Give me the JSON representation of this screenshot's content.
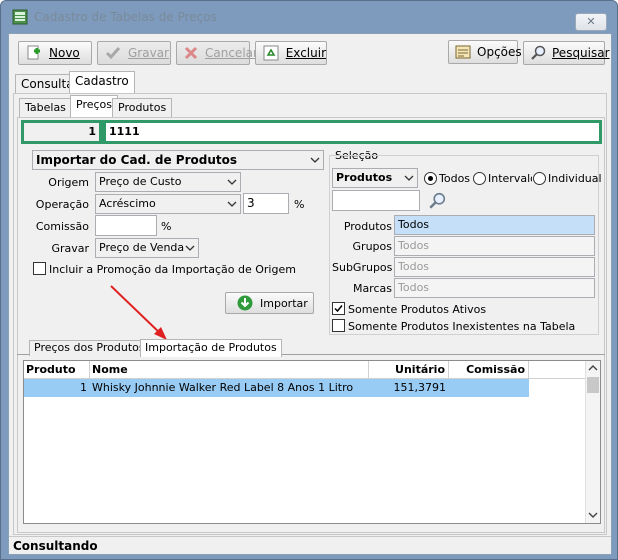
{
  "window": {
    "title": "Cadastro de Tabelas de Preços",
    "close": "✕"
  },
  "toolbar": {
    "novo": "Novo",
    "gravar": "Gravar",
    "cancelar": "Cancelar",
    "excluir": "Excluir",
    "opcoes": "Opções",
    "pesquisar": "Pesquisar"
  },
  "main_tabs": [
    "Consulta",
    "Cadastro"
  ],
  "sub_tabs": [
    "Tabelas",
    "Preços",
    "Produtos"
  ],
  "header_row": {
    "code": "1",
    "name": "1111"
  },
  "import": {
    "mode": "Importar do Cad. de Produtos",
    "origem_label": "Origem",
    "origem_value": "Preço de Custo",
    "operacao_label": "Operação",
    "operacao_value": "Acréscimo",
    "operacao_number": "3",
    "percent1": "%",
    "comissao_label": "Comissão",
    "comissao_value": "",
    "percent2": "%",
    "gravar_label": "Gravar",
    "gravar_value": "Preço de Venda",
    "incluir_label": "Incluir a Promoção da Importação de Origem",
    "incluir_checked": false,
    "importar_button": "Importar"
  },
  "selecao": {
    "title": "Seleção",
    "type_value": "Produtos",
    "radio_todos": "Todos",
    "radio_intervalo": "Intervalo",
    "radio_individual": "Individual",
    "selected_radio": "Todos",
    "search_value": "",
    "produtos_label": "Produtos",
    "produtos_value": "Todos",
    "grupos_label": "Grupos",
    "grupos_value": "Todos",
    "subgrupos_label": "SubGrupos",
    "subgrupos_value": "Todos",
    "marcas_label": "Marcas",
    "marcas_value": "Todos",
    "somente_ativos": "Somente Produtos Ativos",
    "somente_ativos_checked": true,
    "somente_inexistentes": "Somente Produtos Inexistentes na Tabela",
    "somente_inexistentes_checked": false
  },
  "bottom_tabs": [
    "Preços dos Produtos",
    "Importação de Produtos"
  ],
  "grid": {
    "headers": {
      "produto": "Produto",
      "nome": "Nome",
      "unitario": "Unitário",
      "comissao": "Comissão"
    },
    "rows": [
      {
        "produto": "1",
        "nome": "Whisky Johnnie Walker Red Label 8 Anos 1 Litro",
        "unitario": "151,3791",
        "comissao": ""
      }
    ]
  },
  "status": "Consultando",
  "colors": {
    "accent_green": "#2f9a68",
    "row_highlight": "#99ccf5",
    "arrow_red": "#e02020"
  }
}
